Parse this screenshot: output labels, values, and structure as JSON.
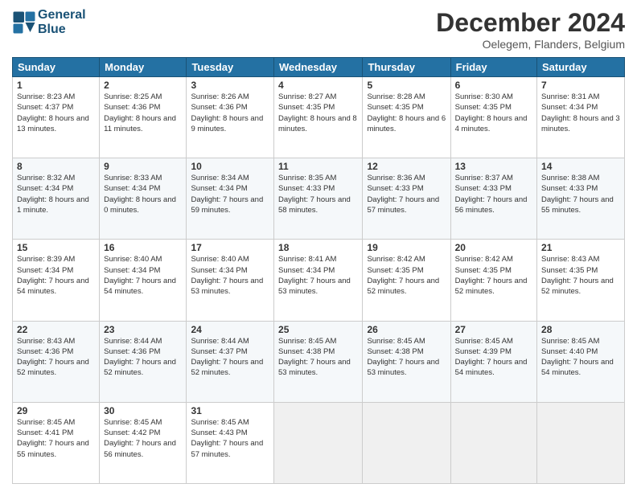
{
  "logo": {
    "line1": "General",
    "line2": "Blue"
  },
  "title": "December 2024",
  "location": "Oelegem, Flanders, Belgium",
  "days_header": [
    "Sunday",
    "Monday",
    "Tuesday",
    "Wednesday",
    "Thursday",
    "Friday",
    "Saturday"
  ],
  "weeks": [
    [
      {
        "day": "1",
        "sunrise": "8:23 AM",
        "sunset": "4:37 PM",
        "daylight": "8 hours and 13 minutes."
      },
      {
        "day": "2",
        "sunrise": "8:25 AM",
        "sunset": "4:36 PM",
        "daylight": "8 hours and 11 minutes."
      },
      {
        "day": "3",
        "sunrise": "8:26 AM",
        "sunset": "4:36 PM",
        "daylight": "8 hours and 9 minutes."
      },
      {
        "day": "4",
        "sunrise": "8:27 AM",
        "sunset": "4:35 PM",
        "daylight": "8 hours and 8 minutes."
      },
      {
        "day": "5",
        "sunrise": "8:28 AM",
        "sunset": "4:35 PM",
        "daylight": "8 hours and 6 minutes."
      },
      {
        "day": "6",
        "sunrise": "8:30 AM",
        "sunset": "4:35 PM",
        "daylight": "8 hours and 4 minutes."
      },
      {
        "day": "7",
        "sunrise": "8:31 AM",
        "sunset": "4:34 PM",
        "daylight": "8 hours and 3 minutes."
      }
    ],
    [
      {
        "day": "8",
        "sunrise": "8:32 AM",
        "sunset": "4:34 PM",
        "daylight": "8 hours and 1 minute."
      },
      {
        "day": "9",
        "sunrise": "8:33 AM",
        "sunset": "4:34 PM",
        "daylight": "8 hours and 0 minutes."
      },
      {
        "day": "10",
        "sunrise": "8:34 AM",
        "sunset": "4:34 PM",
        "daylight": "7 hours and 59 minutes."
      },
      {
        "day": "11",
        "sunrise": "8:35 AM",
        "sunset": "4:33 PM",
        "daylight": "7 hours and 58 minutes."
      },
      {
        "day": "12",
        "sunrise": "8:36 AM",
        "sunset": "4:33 PM",
        "daylight": "7 hours and 57 minutes."
      },
      {
        "day": "13",
        "sunrise": "8:37 AM",
        "sunset": "4:33 PM",
        "daylight": "7 hours and 56 minutes."
      },
      {
        "day": "14",
        "sunrise": "8:38 AM",
        "sunset": "4:33 PM",
        "daylight": "7 hours and 55 minutes."
      }
    ],
    [
      {
        "day": "15",
        "sunrise": "8:39 AM",
        "sunset": "4:34 PM",
        "daylight": "7 hours and 54 minutes."
      },
      {
        "day": "16",
        "sunrise": "8:40 AM",
        "sunset": "4:34 PM",
        "daylight": "7 hours and 54 minutes."
      },
      {
        "day": "17",
        "sunrise": "8:40 AM",
        "sunset": "4:34 PM",
        "daylight": "7 hours and 53 minutes."
      },
      {
        "day": "18",
        "sunrise": "8:41 AM",
        "sunset": "4:34 PM",
        "daylight": "7 hours and 53 minutes."
      },
      {
        "day": "19",
        "sunrise": "8:42 AM",
        "sunset": "4:35 PM",
        "daylight": "7 hours and 52 minutes."
      },
      {
        "day": "20",
        "sunrise": "8:42 AM",
        "sunset": "4:35 PM",
        "daylight": "7 hours and 52 minutes."
      },
      {
        "day": "21",
        "sunrise": "8:43 AM",
        "sunset": "4:35 PM",
        "daylight": "7 hours and 52 minutes."
      }
    ],
    [
      {
        "day": "22",
        "sunrise": "8:43 AM",
        "sunset": "4:36 PM",
        "daylight": "7 hours and 52 minutes."
      },
      {
        "day": "23",
        "sunrise": "8:44 AM",
        "sunset": "4:36 PM",
        "daylight": "7 hours and 52 minutes."
      },
      {
        "day": "24",
        "sunrise": "8:44 AM",
        "sunset": "4:37 PM",
        "daylight": "7 hours and 52 minutes."
      },
      {
        "day": "25",
        "sunrise": "8:45 AM",
        "sunset": "4:38 PM",
        "daylight": "7 hours and 53 minutes."
      },
      {
        "day": "26",
        "sunrise": "8:45 AM",
        "sunset": "4:38 PM",
        "daylight": "7 hours and 53 minutes."
      },
      {
        "day": "27",
        "sunrise": "8:45 AM",
        "sunset": "4:39 PM",
        "daylight": "7 hours and 54 minutes."
      },
      {
        "day": "28",
        "sunrise": "8:45 AM",
        "sunset": "4:40 PM",
        "daylight": "7 hours and 54 minutes."
      }
    ],
    [
      {
        "day": "29",
        "sunrise": "8:45 AM",
        "sunset": "4:41 PM",
        "daylight": "7 hours and 55 minutes."
      },
      {
        "day": "30",
        "sunrise": "8:45 AM",
        "sunset": "4:42 PM",
        "daylight": "7 hours and 56 minutes."
      },
      {
        "day": "31",
        "sunrise": "8:45 AM",
        "sunset": "4:43 PM",
        "daylight": "7 hours and 57 minutes."
      },
      null,
      null,
      null,
      null
    ]
  ]
}
